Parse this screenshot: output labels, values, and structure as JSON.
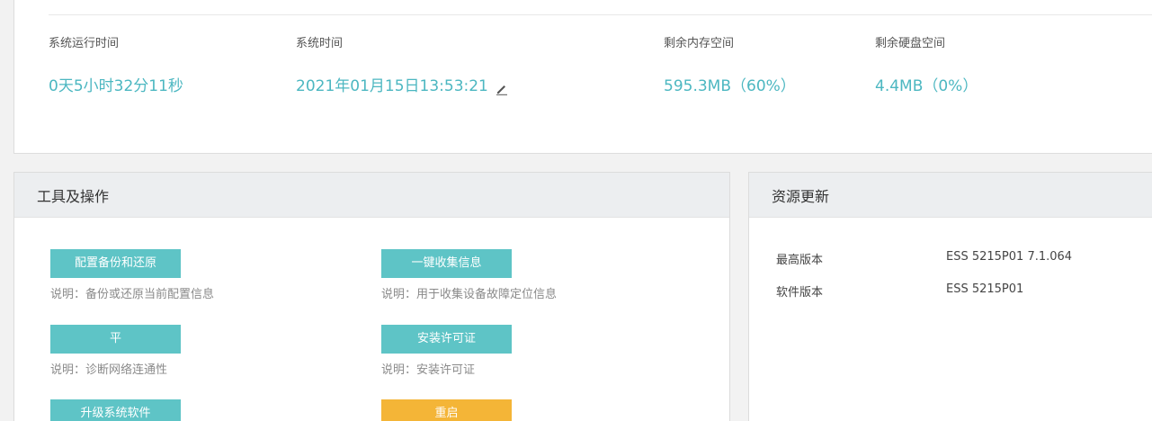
{
  "status": {
    "items": [
      {
        "label": "系统运行时间",
        "value": "0天5小时32分11秒"
      },
      {
        "label": "系统时间",
        "value": "2021年01月15日13:53:21"
      },
      {
        "label": "剩余内存空间",
        "value": "595.3MB（60%）"
      },
      {
        "label": "剩余硬盘空间",
        "value": "4.4MB（0%）"
      }
    ]
  },
  "tools": {
    "title": "工具及操作",
    "buttons": [
      {
        "label": "配置备份和还原",
        "desc": "说明：备份或还原当前配置信息"
      },
      {
        "label": "一键收集信息",
        "desc": "说明：用于收集设备故障定位信息"
      },
      {
        "label": "平",
        "desc": "说明：诊断网络连通性"
      },
      {
        "label": "安装许可证",
        "desc": "说明：安装许可证"
      },
      {
        "label": "升级系统软件"
      },
      {
        "label": "重启"
      }
    ]
  },
  "resources": {
    "title": "资源更新",
    "rows": [
      {
        "key": "最高版本",
        "value": "ESS 5215P01 7.1.064"
      },
      {
        "key": "软件版本",
        "value": "ESS 5215P01"
      }
    ]
  },
  "colors": {
    "accent": "#4cb7c1",
    "button": "#5ec4c6",
    "warning_button": "#f4b537"
  },
  "icons": {
    "edit_time": "pencil-edit-icon"
  }
}
